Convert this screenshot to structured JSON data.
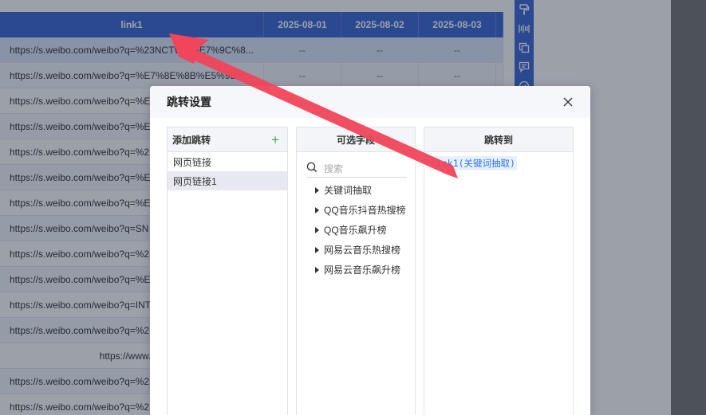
{
  "table": {
    "headers": {
      "link": "link1",
      "dates": [
        "2025-08-01",
        "2025-08-02",
        "2025-08-03"
      ]
    },
    "rows": [
      {
        "link": "https://s.weibo.com/weibo?q=%23NCTW...%E7%9C%8...",
        "values": [
          "--",
          "--",
          "--"
        ]
      },
      {
        "link": "https://s.weibo.com/weibo?q=%E7%8E%8B%E5%9B%...",
        "values": [
          "--",
          "--",
          "--"
        ]
      },
      {
        "link": "https://s.weibo.com/weibo?q=%E",
        "values": []
      },
      {
        "link": "https://s.weibo.com/weibo?q=%E",
        "values": []
      },
      {
        "link": "https://s.weibo.com/weibo?q=%2",
        "values": []
      },
      {
        "link": "https://s.weibo.com/weibo?q=%E",
        "values": []
      },
      {
        "link": "https://s.weibo.com/weibo?q=%E",
        "values": []
      },
      {
        "link": "https://s.weibo.com/weibo?q=SN",
        "values": []
      },
      {
        "link": "https://s.weibo.com/weibo?q=%2",
        "values": []
      },
      {
        "link": "https://s.weibo.com/weibo?q=%E",
        "values": []
      },
      {
        "link": "https://s.weibo.com/weibo?q=INT",
        "values": []
      },
      {
        "link": "https://s.weibo.com/weibo?q=%2",
        "values": []
      },
      {
        "link": "https://www.bai",
        "values": []
      },
      {
        "link": "https://s.weibo.com/weibo?q=%2",
        "values": []
      },
      {
        "link": "https://s.weibo.com/weibo?q=%2",
        "values": []
      }
    ]
  },
  "toolbar": {
    "icons": [
      "brush-icon",
      "barcode-icon",
      "copy-icon",
      "comment-icon",
      "check-circle-icon"
    ]
  },
  "modal": {
    "title": "跳转设置",
    "add_panel": {
      "title": "添加跳转",
      "add_icon": "+",
      "items": [
        {
          "label": "网页链接",
          "active": false
        },
        {
          "label": "网页链接1",
          "active": true
        }
      ]
    },
    "fields_panel": {
      "title": "可选字段",
      "search_placeholder": "搜索",
      "items": [
        "关键词抽取",
        "QQ音乐抖音热搜榜",
        "QQ音乐飙升榜",
        "网易云音乐热搜榜",
        "网易云音乐飙升榜"
      ]
    },
    "target_panel": {
      "title": "跳转到",
      "value": "link1(关键词抽取)"
    }
  },
  "colors": {
    "header_blue": "#3d6ad6",
    "annotation_red": "#f0455a",
    "add_green": "#2eaa52",
    "target_text": "#2f73e0"
  }
}
